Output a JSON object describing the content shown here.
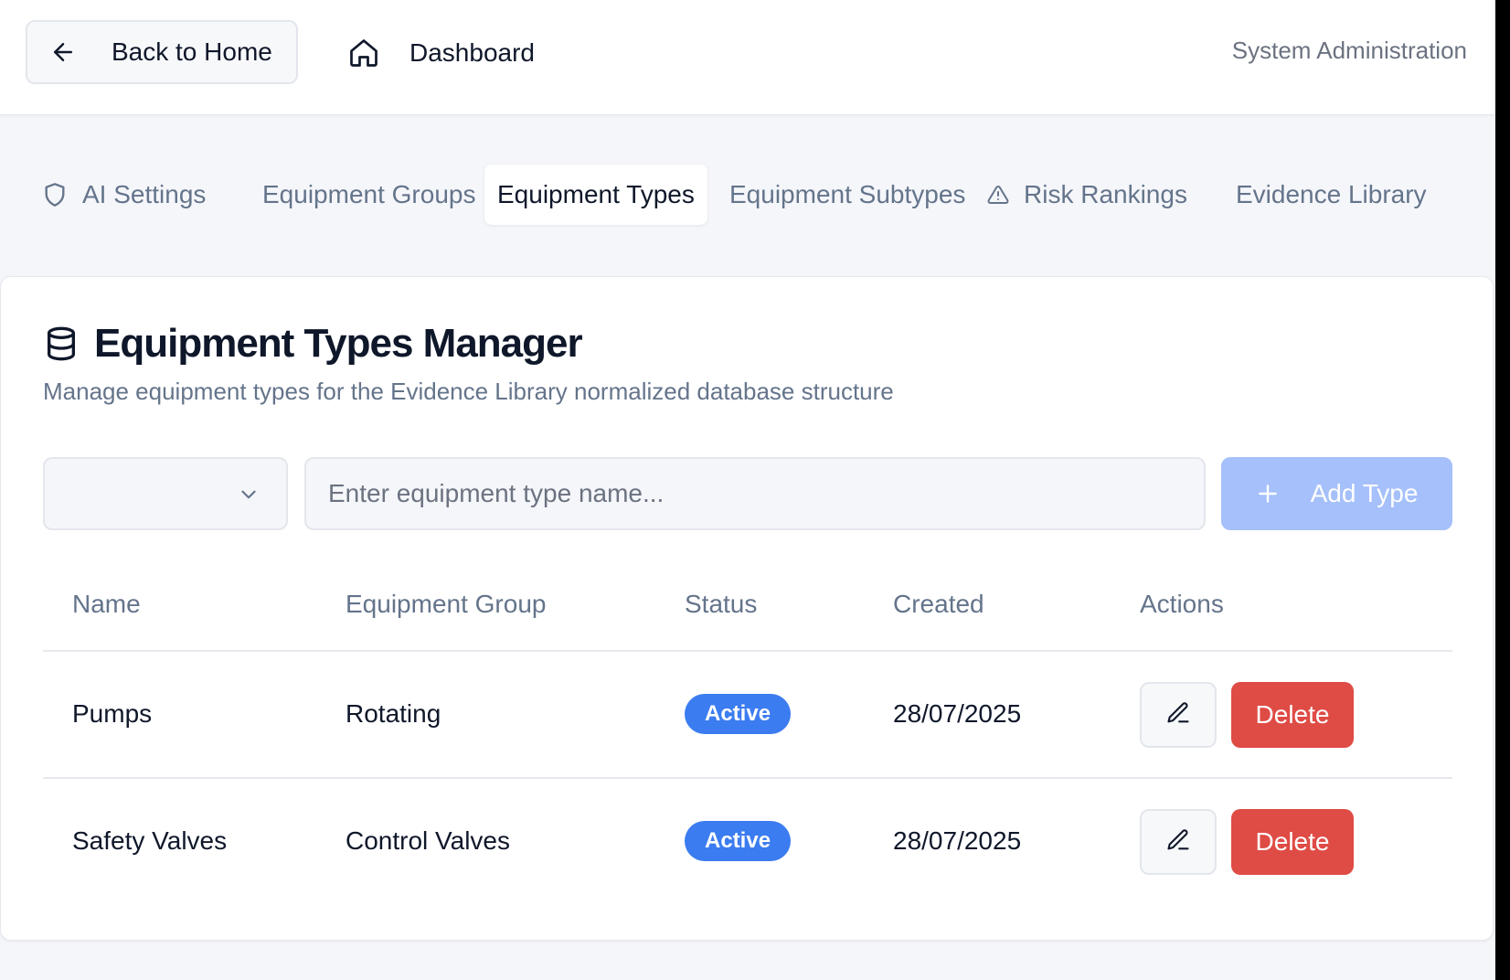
{
  "header": {
    "back_label": "Back to Home",
    "back_icon": "arrow-left-icon",
    "dashboard_label": "Dashboard",
    "dashboard_icon": "home-icon",
    "context_label": "System Administration"
  },
  "tabs": [
    {
      "label": "AI Settings",
      "icon": "shield-icon",
      "active": false
    },
    {
      "label": "Equipment Groups",
      "active": false
    },
    {
      "label": "Equipment Types",
      "active": true
    },
    {
      "label": "Equipment Subtypes",
      "active": false
    },
    {
      "label": "Risk Rankings",
      "icon": "warning-triangle-icon",
      "active": false
    },
    {
      "label": "Evidence Library",
      "active": false
    }
  ],
  "manager": {
    "title": "Equipment Types Manager",
    "title_icon": "database-icon",
    "description": "Manage equipment types for the Evidence Library normalized database structure",
    "group_select_value": "",
    "name_input_value": "",
    "name_input_placeholder": "Enter equipment type name...",
    "add_label": "Add Type"
  },
  "table": {
    "columns": [
      "Name",
      "Equipment Group",
      "Status",
      "Created",
      "Actions"
    ],
    "rows": [
      {
        "name": "Pumps",
        "group": "Rotating",
        "status": "Active",
        "created": "28/07/2025",
        "delete_label": "Delete"
      },
      {
        "name": "Safety Valves",
        "group": "Control Valves",
        "status": "Active",
        "created": "28/07/2025",
        "delete_label": "Delete"
      }
    ]
  },
  "colors": {
    "accent": "#3b7cf0",
    "add_button_disabled": "#a5c0fa",
    "danger": "#df4b45",
    "background": "#f5f6fa"
  }
}
